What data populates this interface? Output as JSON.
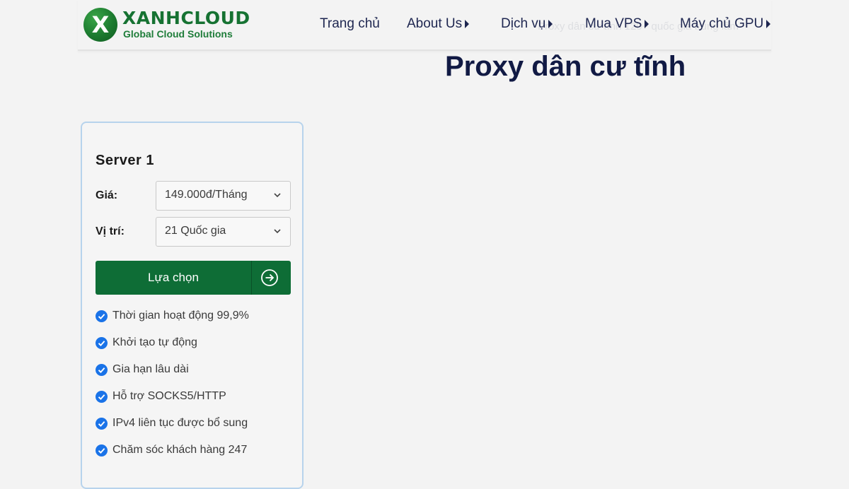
{
  "brand": {
    "logo_letter": "X",
    "name": "XANHCLOUD",
    "tagline": "Global Cloud Solutions",
    "primary_color": "#167232",
    "button_color": "#0e6d36"
  },
  "nav": {
    "items": [
      {
        "label": "Trang chủ",
        "has_submenu": false
      },
      {
        "label": "About Us",
        "has_submenu": true
      },
      {
        "label": "Dịch vụ",
        "has_submenu": true
      },
      {
        "label": "Mua VPS",
        "has_submenu": true
      },
      {
        "label": "Máy chủ GPU",
        "has_submenu": true
      }
    ]
  },
  "background_text": "Proxy dân cư tĩnh 120+ quốc gia trung lâm",
  "page": {
    "title": "Proxy dân cư tĩnh"
  },
  "card": {
    "title": "Server 1",
    "price_label": "Giá:",
    "price_value": "149.000đ/Tháng",
    "location_label": "Vị trí:",
    "location_value": "21 Quốc gia",
    "select_button_label": "Lựa chọn",
    "features": [
      "Thời gian hoạt động 99,9%",
      "Khởi tạo tự động",
      "Gia hạn lâu dài",
      "Hỗ trợ SOCKS5/HTTP",
      "IPv4 liên tục được bổ sung",
      "Chăm sóc khách hàng 247"
    ],
    "check_color": "#1a73e8",
    "border_color": "#b7d3ec"
  }
}
